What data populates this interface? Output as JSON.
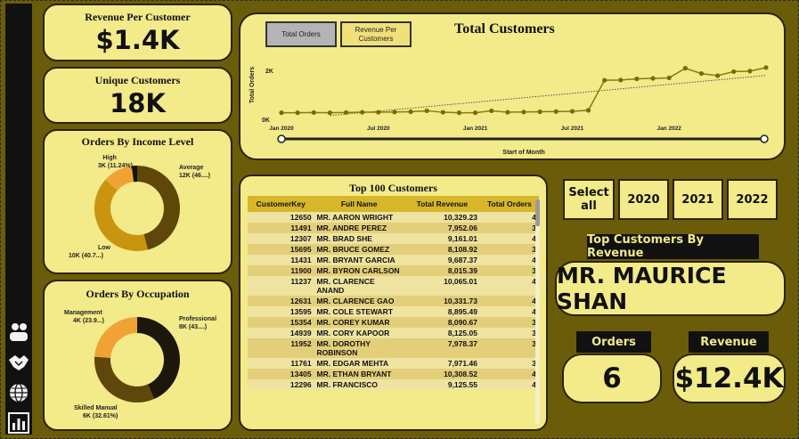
{
  "kpis": {
    "revenue_per_customer": {
      "title": "Revenue Per Customer",
      "value": "$1.4K"
    },
    "unique_customers": {
      "title": "Unique Customers",
      "value": "18K"
    }
  },
  "income_donut": {
    "title": "Orders By Income Level",
    "slices": [
      {
        "label": "Average",
        "value_text": "12K (46....)",
        "pct": 46.0,
        "color": "#5e4709"
      },
      {
        "label": "Low",
        "value_text": "10K (40.7...)",
        "pct": 40.7,
        "color": "#c9940e"
      },
      {
        "label": "High",
        "value_text": "3K (11.24%)",
        "pct": 11.24,
        "color": "#f0a334"
      },
      {
        "label": "",
        "value_text": "",
        "pct": 2.06,
        "color": "#111111"
      }
    ]
  },
  "occupation_donut": {
    "title": "Orders By Occupation",
    "slices": [
      {
        "label": "Professional",
        "value_text": "8K (43....)",
        "pct": 43.5,
        "color": "#1c170c"
      },
      {
        "label": "Skilled Manual",
        "value_text": "6K (32.61%)",
        "pct": 32.61,
        "color": "#5e4709"
      },
      {
        "label": "Management",
        "value_text": "4K (23.9...)",
        "pct": 23.89,
        "color": "#f0a334"
      }
    ]
  },
  "line_chart": {
    "title": "Total Customers",
    "toggle_orders": "Total Orders",
    "toggle_revenue": "Revenue Per Customers",
    "xlabel": "Start of Month",
    "ylabel": "Total Orders",
    "ytick_top": "2K",
    "ytick_bottom": "0K",
    "xticks": [
      "Jan 2020",
      "Jul 2020",
      "Jan 2021",
      "Jul 2021",
      "Jan 2022"
    ]
  },
  "chart_data": {
    "type": "line",
    "title": "Total Customers",
    "xlabel": "Start of Month",
    "ylabel": "Total Orders",
    "ylim": [
      0,
      2600
    ],
    "trendline": true,
    "x": [
      "2020-01",
      "2020-02",
      "2020-03",
      "2020-04",
      "2020-05",
      "2020-06",
      "2020-07",
      "2020-08",
      "2020-09",
      "2020-10",
      "2020-11",
      "2020-12",
      "2021-01",
      "2021-02",
      "2021-03",
      "2021-04",
      "2021-05",
      "2021-06",
      "2021-07",
      "2021-08",
      "2021-09",
      "2021-10",
      "2021-11",
      "2021-12",
      "2022-01",
      "2022-02",
      "2022-03",
      "2022-04",
      "2022-05",
      "2022-06",
      "2022-07"
    ],
    "series": [
      {
        "values": [
          200,
          200,
          210,
          200,
          210,
          220,
          220,
          230,
          240,
          280,
          220,
          200,
          200,
          280,
          220,
          230,
          240,
          250,
          260,
          300,
          1550,
          1560,
          1610,
          1630,
          1650,
          2050,
          1830,
          1740,
          1910,
          1930,
          2080
        ]
      }
    ]
  },
  "table": {
    "title": "Top 100 Customers",
    "headers": [
      "CustomerKey",
      "Full Name",
      "Total Revenue",
      "Total Orders"
    ],
    "rows": [
      [
        "12650",
        "MR. AARON WRIGHT",
        "10,329.23",
        "4"
      ],
      [
        "11491",
        "MR. ANDRE PEREZ",
        "7,952.06",
        "3"
      ],
      [
        "12307",
        "MR. BRAD SHE",
        "9,161.01",
        "4"
      ],
      [
        "15695",
        "MR. BRUCE GOMEZ",
        "8,108.92",
        "3"
      ],
      [
        "11431",
        "MR. BRYANT GARCIA",
        "9,687.37",
        "4"
      ],
      [
        "11900",
        "MR. BYRON CARLSON",
        "8,015.39",
        "3"
      ],
      [
        "11237",
        "MR. CLARENCE ANAND",
        "10,065.01",
        "4"
      ],
      [
        "12631",
        "MR. CLARENCE GAO",
        "10,331.73",
        "4"
      ],
      [
        "13595",
        "MR. COLE STEWART",
        "8,895.49",
        "4"
      ],
      [
        "15354",
        "MR. COREY KUMAR",
        "8,090.67",
        "3"
      ],
      [
        "14939",
        "MR. CORY KAPOOR",
        "8,125.05",
        "3"
      ],
      [
        "11952",
        "MR. DOROTHY ROBINSON",
        "7,978.37",
        "3"
      ],
      [
        "11761",
        "MR. EDGAR MEHTA",
        "7,971.46",
        "3"
      ],
      [
        "13405",
        "MR. ETHAN BRYANT",
        "10,308.52",
        "4"
      ],
      [
        "12296",
        "MR. FRANCISCO",
        "9,125.55",
        "4"
      ]
    ]
  },
  "year_slicer": [
    "Select all",
    "2020",
    "2021",
    "2022"
  ],
  "top_customer": {
    "label": "Top Customers By Revenue",
    "name": "MR. MAURICE SHAN"
  },
  "orders": {
    "label": "Orders",
    "value": "6"
  },
  "revenue": {
    "label": "Revenue",
    "value": "$12.4K"
  }
}
